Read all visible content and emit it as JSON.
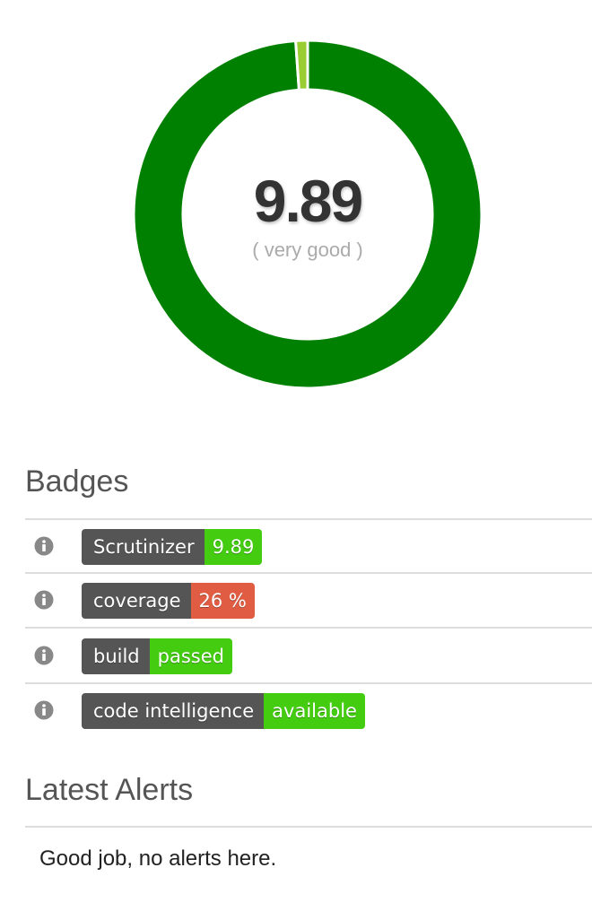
{
  "score": {
    "value": "9.89",
    "label": "( very good )",
    "max": 10,
    "colors": {
      "main": "#008000",
      "remainder": "#9acd32"
    }
  },
  "badges_section": {
    "title": "Badges",
    "items": [
      {
        "label": "Scrutinizer",
        "value": "9.89",
        "value_color": "#4c1",
        "icon": "info-icon"
      },
      {
        "label": "coverage",
        "value": "26 %",
        "value_color": "#e05d44",
        "icon": "info-icon"
      },
      {
        "label": "build",
        "value": "passed",
        "value_color": "#4c1",
        "icon": "info-icon"
      },
      {
        "label": "code intelligence",
        "value": "available",
        "value_color": "#4c1",
        "icon": "info-icon"
      }
    ]
  },
  "alerts_section": {
    "title": "Latest Alerts",
    "message": "Good job, no alerts here."
  }
}
